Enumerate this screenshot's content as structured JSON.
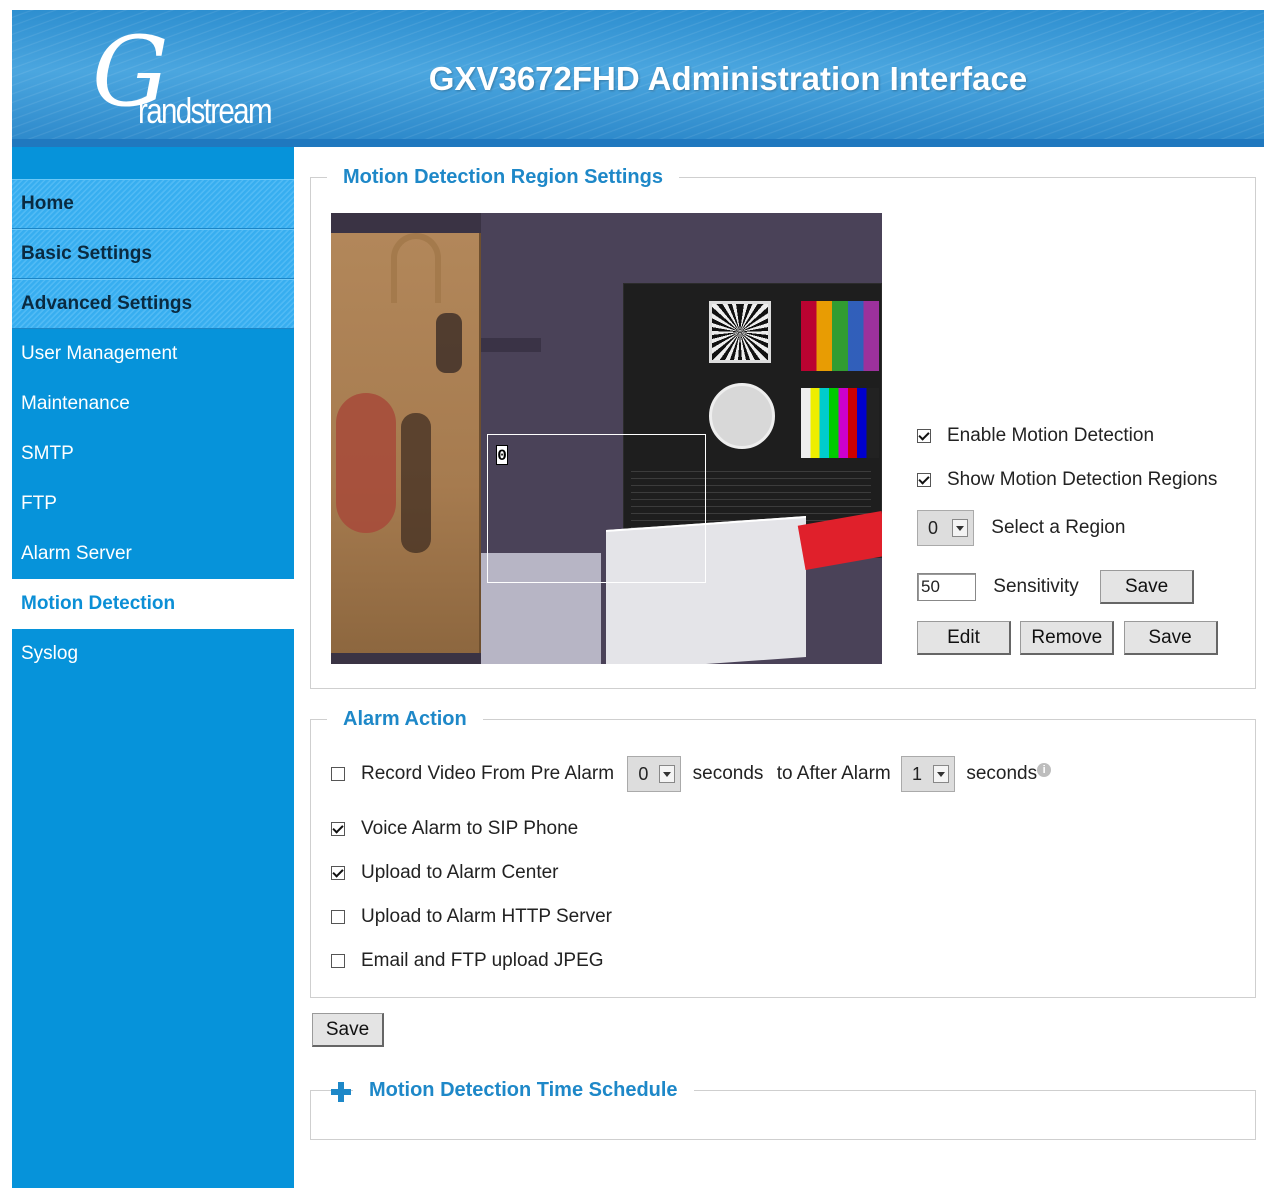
{
  "header": {
    "logo_letter": "G",
    "logo_text": "randstream",
    "title": "GXV3672FHD Administration Interface"
  },
  "sidebar": {
    "items": [
      {
        "label": "Home",
        "type": "section"
      },
      {
        "label": "Basic Settings",
        "type": "section"
      },
      {
        "label": "Advanced Settings",
        "type": "section"
      },
      {
        "label": "User Management",
        "type": "link"
      },
      {
        "label": "Maintenance",
        "type": "link"
      },
      {
        "label": "SMTP",
        "type": "link"
      },
      {
        "label": "FTP",
        "type": "link"
      },
      {
        "label": "Alarm Server",
        "type": "link"
      },
      {
        "label": "Motion Detection",
        "type": "active"
      },
      {
        "label": "Syslog",
        "type": "link"
      }
    ]
  },
  "region_settings": {
    "legend": "Motion Detection Region Settings",
    "region_label": "0",
    "enable_motion_detection": {
      "label": "Enable Motion Detection",
      "checked": true
    },
    "show_regions": {
      "label": "Show Motion Detection Regions",
      "checked": true
    },
    "select_region": {
      "value": "0",
      "label": "Select a Region"
    },
    "sensitivity": {
      "value": "50",
      "label": "Sensitivity",
      "save_label": "Save"
    },
    "edit_label": "Edit",
    "remove_label": "Remove",
    "save_label": "Save"
  },
  "alarm_action": {
    "legend": "Alarm Action",
    "record": {
      "label": "Record Video From Pre Alarm",
      "checked": false,
      "pre_value": "0",
      "seconds1": "seconds",
      "to_after": "to After Alarm",
      "after_value": "1",
      "seconds2": "seconds"
    },
    "voice_alarm": {
      "label": "Voice Alarm to SIP Phone",
      "checked": true
    },
    "upload_center": {
      "label": "Upload to Alarm Center",
      "checked": true
    },
    "upload_http": {
      "label": "Upload to Alarm HTTP Server",
      "checked": false
    },
    "email_ftp": {
      "label": "Email and FTP upload JPEG",
      "checked": false
    }
  },
  "save_label": "Save",
  "schedule": {
    "legend": "Motion Detection Time Schedule"
  }
}
